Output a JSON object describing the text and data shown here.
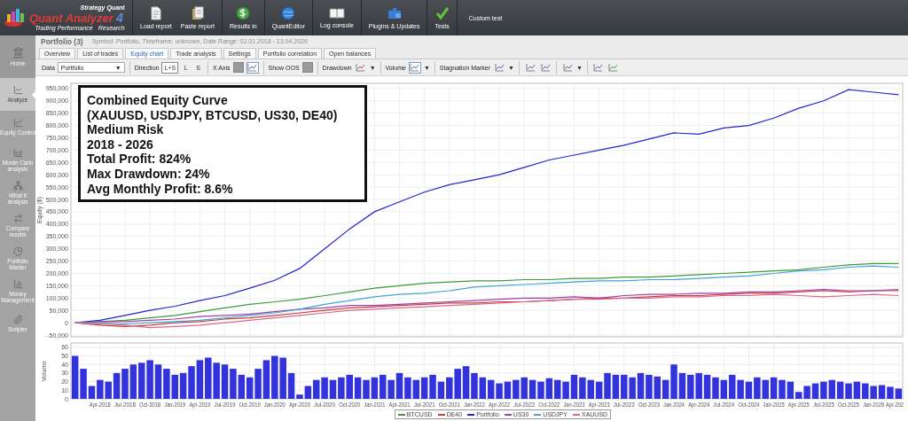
{
  "logo": {
    "brand": "Strategy Quant",
    "name": "Quant Analyzer",
    "version": "4",
    "tagline": "Trading Performance",
    "tagline_2": "Research"
  },
  "toolbar": [
    {
      "label": "Load report"
    },
    {
      "label": "Paste report"
    },
    {
      "label": "Results in"
    },
    {
      "label": "QuantEditor"
    },
    {
      "label": "Log console"
    },
    {
      "label": "Plugins & Updates"
    },
    {
      "label": "Tests"
    },
    {
      "label": "Custom test"
    }
  ],
  "sidebar": {
    "items": [
      {
        "label": "Home",
        "selected": false
      },
      {
        "label": "Analyze",
        "selected": true
      },
      {
        "label": "Equity Control",
        "selected": false
      },
      {
        "label": "Monte Carlo analysis",
        "selected": false
      },
      {
        "label": "What If analysis",
        "selected": false
      },
      {
        "label": "Compare results",
        "selected": false
      },
      {
        "label": "Portfolio Master",
        "selected": false
      },
      {
        "label": "Money Management",
        "selected": false
      },
      {
        "label": "Scripter",
        "selected": false
      }
    ]
  },
  "document": {
    "title": "Portfolio (3)",
    "subtitle": "Symbol: Portfolio, Timeframe: unknown, Date Range: 02.01.2018 - 13.04.2026"
  },
  "tabs": [
    {
      "label": "Overview",
      "selected": false
    },
    {
      "label": "List of trades",
      "selected": false
    },
    {
      "label": "Equity chart",
      "selected": true
    },
    {
      "label": "Trade analysis",
      "selected": false
    },
    {
      "label": "Settings",
      "selected": false
    },
    {
      "label": "Portfolio correlation",
      "selected": false
    },
    {
      "label": "Open balances",
      "selected": false
    }
  ],
  "controls": {
    "data": {
      "label": "Data",
      "value": "Portfolio",
      "caret": "▼"
    },
    "direction": {
      "label": "Direction",
      "options": [
        {
          "label": "L+S",
          "selected": true
        },
        {
          "label": "L",
          "selected": false
        },
        {
          "label": "S",
          "selected": false
        }
      ]
    },
    "x_axis": {
      "label": "X Axis",
      "options": [
        {
          "selected": false
        },
        {
          "selected": true
        }
      ]
    },
    "show_oos": {
      "label": "Show OOS"
    },
    "drawdown": {
      "label": "Drawdown",
      "caret": "▼"
    },
    "volume": {
      "label": "Volume",
      "caret": "▼"
    },
    "stagnation": {
      "label": "Stagnation Marker",
      "caret": "▼"
    },
    "chart_style": {
      "caret": "▼"
    }
  },
  "note_lines": [
    "Combined Equity Curve",
    "(XAUUSD, USDJPY, BTCUSD, US30, DE40)",
    "Medium Risk",
    "2018 - 2026",
    "Total Profit: 824%",
    "Max Drawdown: 24%",
    "Avg Monthly Profit: 8.6%"
  ],
  "equity_chart": {
    "chart_data": {
      "type": "line",
      "ylabel": "Equity ($)",
      "grid": true,
      "ylim": [
        -57000,
        971000
      ],
      "categories": [
        null,
        null,
        null,
        null,
        null,
        null,
        null,
        null,
        null,
        null,
        null,
        null,
        null,
        null,
        null,
        null,
        null,
        null,
        null,
        null,
        null,
        null,
        null,
        null,
        null,
        null,
        null,
        null,
        null,
        null,
        null,
        null,
        null,
        null
      ],
      "yticks": [
        {
          "value": -50000,
          "label": "-50,000"
        },
        {
          "value": 0,
          "label": "0"
        },
        {
          "value": 50000,
          "label": "50,000"
        },
        {
          "value": 100000,
          "label": "100,000"
        },
        {
          "value": 150000,
          "label": "150,000"
        },
        {
          "value": 200000,
          "label": "200,000"
        },
        {
          "value": 250000,
          "label": "250,000"
        },
        {
          "value": 300000,
          "label": "300,000"
        },
        {
          "value": 350000,
          "label": "350,000"
        },
        {
          "value": 400000,
          "label": "400,000"
        },
        {
          "value": 450000,
          "label": "450,000"
        },
        {
          "value": 500000,
          "label": "500,000"
        },
        {
          "value": 550000,
          "label": "550,000"
        },
        {
          "value": 600000,
          "label": "600,000"
        },
        {
          "value": 650000,
          "label": "650,000"
        },
        {
          "value": 700000,
          "label": "700,000"
        },
        {
          "value": 750000,
          "label": "750,000"
        },
        {
          "value": 800000,
          "label": "800,000"
        },
        {
          "value": 850000,
          "label": "850,000"
        },
        {
          "value": 900000,
          "label": "900,000"
        },
        {
          "value": 950000,
          "label": "950,000"
        }
      ],
      "series": [
        {
          "name": "BTCUSD",
          "color": "#3c9a3c",
          "values": [
            0,
            5000,
            10000,
            20000,
            30000,
            45000,
            60000,
            75000,
            85000,
            95000,
            110000,
            125000,
            140000,
            150000,
            160000,
            165000,
            170000,
            170000,
            175000,
            175000,
            180000,
            180000,
            185000,
            185000,
            190000,
            195000,
            200000,
            205000,
            210000,
            215000,
            225000,
            235000,
            240000,
            240000
          ]
        },
        {
          "name": "DE40",
          "color": "#d03a3a",
          "values": [
            0,
            -10000,
            -15000,
            -10000,
            0,
            5000,
            15000,
            20000,
            30000,
            40000,
            50000,
            60000,
            65000,
            70000,
            75000,
            80000,
            80000,
            85000,
            85000,
            90000,
            95000,
            100000,
            100000,
            105000,
            110000,
            110000,
            115000,
            120000,
            120000,
            125000,
            130000,
            125000,
            130000,
            130000
          ]
        },
        {
          "name": "Portfolio",
          "color": "#2424cc",
          "values": [
            0,
            10000,
            30000,
            50000,
            67000,
            90000,
            110000,
            140000,
            172000,
            220000,
            300000,
            380000,
            450000,
            490000,
            530000,
            560000,
            580000,
            600000,
            630000,
            660000,
            680000,
            700000,
            720000,
            745000,
            770000,
            765000,
            790000,
            800000,
            830000,
            870000,
            900000,
            945000,
            935000,
            925000
          ]
        },
        {
          "name": "US30",
          "color": "#a040a8",
          "values": [
            0,
            5000,
            5000,
            10000,
            15000,
            25000,
            30000,
            35000,
            45000,
            55000,
            60000,
            70000,
            70000,
            75000,
            80000,
            85000,
            90000,
            95000,
            100000,
            100000,
            105000,
            100000,
            110000,
            115000,
            115000,
            120000,
            120000,
            125000,
            125000,
            130000,
            135000,
            130000,
            130000,
            135000
          ]
        },
        {
          "name": "USDJPY",
          "color": "#40a4d4",
          "values": [
            0,
            0,
            -5000,
            0,
            5000,
            10000,
            20000,
            30000,
            40000,
            55000,
            75000,
            90000,
            105000,
            115000,
            120000,
            130000,
            145000,
            150000,
            155000,
            160000,
            165000,
            170000,
            170000,
            175000,
            175000,
            180000,
            185000,
            190000,
            200000,
            210000,
            215000,
            225000,
            230000,
            225000
          ]
        },
        {
          "name": "XAUUSD",
          "color": "#d86a8c",
          "values": [
            0,
            -5000,
            -10000,
            -20000,
            -15000,
            -10000,
            0,
            10000,
            20000,
            30000,
            40000,
            50000,
            55000,
            60000,
            65000,
            70000,
            75000,
            80000,
            85000,
            90000,
            95000,
            95000,
            100000,
            100000,
            105000,
            105000,
            110000,
            110000,
            115000,
            110000,
            105000,
            110000,
            115000,
            110000
          ]
        }
      ]
    }
  },
  "volume_chart": {
    "chart_data": {
      "type": "bar",
      "ylabel": "Volume",
      "grid": true,
      "ylim": [
        0,
        65
      ],
      "yticks": [
        0,
        10,
        20,
        30,
        40,
        50,
        60
      ],
      "categories": [
        null,
        null,
        null,
        "Apr-2018",
        null,
        null,
        "Jul-2018",
        null,
        null,
        "Oct-2018",
        null,
        null,
        "Jan-2019",
        null,
        null,
        "Apr-2019",
        null,
        null,
        "Jul-2019",
        null,
        null,
        "Oct-2019",
        null,
        null,
        "Jan-2020",
        null,
        null,
        "Apr-2020",
        null,
        null,
        "Jul-2020",
        null,
        null,
        "Oct-2020",
        null,
        null,
        "Jan-2021",
        null,
        null,
        "Apr-2021",
        null,
        null,
        "Jul-2021",
        null,
        null,
        "Oct-2021",
        null,
        null,
        "Jan-2022",
        null,
        null,
        "Apr-2022",
        null,
        null,
        "Jul-2022",
        null,
        null,
        "Oct-2022",
        null,
        null,
        "Jan-2023",
        null,
        null,
        "Apr-2023",
        null,
        null,
        "Jul-2023",
        null,
        null,
        "Oct-2023",
        null,
        null,
        "Jan-2024",
        null,
        null,
        "Apr-2024",
        null,
        null,
        "Jul-2024",
        null,
        null,
        "Oct-2024",
        null,
        null,
        "Jan-2025",
        null,
        null,
        "Apr-2025",
        null,
        null,
        "Jul-2025",
        null,
        null,
        "Oct-2025",
        null,
        null,
        "Jan-2026",
        null,
        null,
        "Apr-202"
      ],
      "values": [
        50,
        35,
        15,
        22,
        20,
        30,
        35,
        40,
        42,
        45,
        40,
        35,
        28,
        30,
        38,
        45,
        48,
        42,
        40,
        35,
        28,
        25,
        35,
        45,
        50,
        48,
        30,
        5,
        15,
        22,
        25,
        22,
        25,
        28,
        25,
        22,
        25,
        28,
        22,
        30,
        25,
        22,
        25,
        28,
        20,
        25,
        35,
        38,
        30,
        25,
        22,
        18,
        20,
        22,
        25,
        22,
        20,
        24,
        22,
        20,
        28,
        25,
        22,
        20,
        30,
        28,
        28,
        25,
        30,
        28,
        26,
        22,
        40,
        30,
        28,
        30,
        28,
        25,
        22,
        28,
        22,
        20,
        25,
        22,
        25,
        22,
        20,
        8,
        15,
        18,
        20,
        22,
        20,
        18,
        20,
        18,
        15,
        16,
        14,
        12
      ]
    }
  }
}
